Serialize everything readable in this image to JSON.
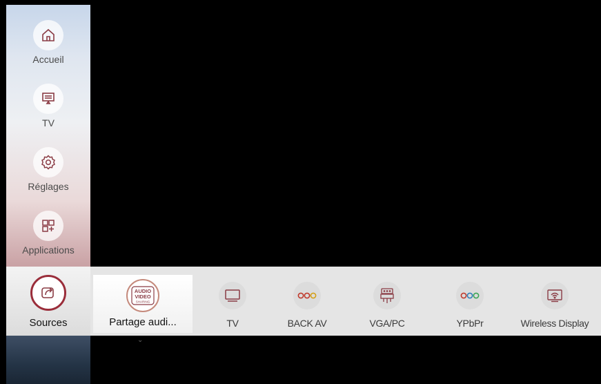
{
  "sidebar": {
    "items": [
      {
        "label": "Accueil",
        "icon": "home-icon"
      },
      {
        "label": "TV",
        "icon": "tv-monitor-icon"
      },
      {
        "label": "Réglages",
        "icon": "gear-icon"
      },
      {
        "label": "Applications",
        "icon": "apps-grid-icon"
      }
    ],
    "active": {
      "label": "Sources",
      "icon": "share-arrow-icon"
    }
  },
  "sources": [
    {
      "label": "Partage audi...",
      "icon": "audio-video-sharing-icon",
      "icon_text": [
        "AUDIO",
        "VIDEO",
        "SHARING"
      ],
      "selected": true
    },
    {
      "label": "TV",
      "icon": "tv-icon"
    },
    {
      "label": "BACK AV",
      "icon": "av-rca-icon"
    },
    {
      "label": "VGA/PC",
      "icon": "vga-connector-icon"
    },
    {
      "label": "YPbPr",
      "icon": "component-rca-icon"
    },
    {
      "label": "Wireless Display",
      "icon": "wireless-display-icon"
    }
  ],
  "colors": {
    "accent": "#9a2d3a",
    "bar": "#e5e5e5",
    "background": "#000000"
  }
}
